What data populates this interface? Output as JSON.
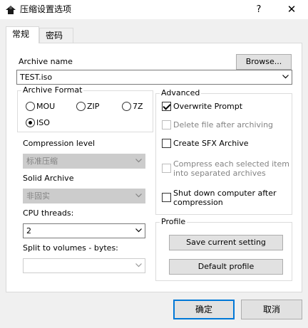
{
  "window": {
    "title": "压缩设置选项",
    "help_glyph": "?",
    "close_glyph": "✕"
  },
  "tabs": [
    {
      "label": "常规",
      "active": true
    },
    {
      "label": "密码",
      "active": false
    }
  ],
  "archive": {
    "name_label": "Archive name",
    "browse_label": "Browse...",
    "name_value": "TEST.iso"
  },
  "format": {
    "title": "Archive Format",
    "options": [
      {
        "label": "MOU",
        "checked": false
      },
      {
        "label": "ZIP",
        "checked": false
      },
      {
        "label": "7Z",
        "checked": false
      },
      {
        "label": "ISO",
        "checked": true
      }
    ]
  },
  "compression": {
    "level_label": "Compression level",
    "level_value": "标准压缩",
    "solid_label": "Solid Archive",
    "solid_value": "非固实",
    "threads_label": "CPU threads:",
    "threads_value": "2",
    "split_label": "Split to volumes - bytes:",
    "split_value": ""
  },
  "advanced": {
    "title": "Advanced",
    "overwrite": {
      "label": "Overwrite Prompt",
      "checked": true,
      "enabled": true
    },
    "delete_after": {
      "label": "Delete file after archiving",
      "checked": false,
      "enabled": false
    },
    "create_sfx": {
      "label": "Create SFX Archive",
      "checked": false,
      "enabled": true
    },
    "compress_each_line1": "Compress each selected item",
    "compress_each_line2": "into separated archives",
    "shutdown_line1": "Shut down computer after",
    "shutdown_line2": "compression"
  },
  "profile": {
    "title": "Profile",
    "save_label": "Save current setting",
    "default_label": "Default profile"
  },
  "footer": {
    "ok_label": "确定",
    "cancel_label": "取消"
  },
  "colors": {
    "accent": "#0078d7",
    "panel_bg": "#f0f0f0",
    "disabled_text": "#838383"
  }
}
